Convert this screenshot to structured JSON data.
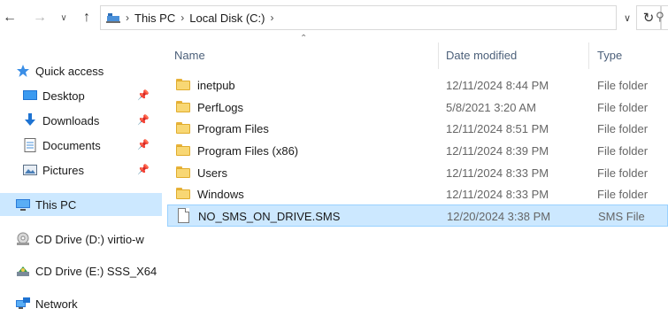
{
  "address_bar": {
    "breadcrumbs": [
      "This PC",
      "Local Disk (C:)"
    ]
  },
  "sidebar": {
    "items": [
      {
        "label": "Quick access",
        "icon": "star-icon",
        "pinned": false
      },
      {
        "label": "Desktop",
        "icon": "desktop-icon",
        "pinned": true
      },
      {
        "label": "Downloads",
        "icon": "download-icon",
        "pinned": true
      },
      {
        "label": "Documents",
        "icon": "documents-icon",
        "pinned": true
      },
      {
        "label": "Pictures",
        "icon": "pictures-icon",
        "pinned": true
      },
      {
        "label": "This PC",
        "icon": "computer-icon",
        "pinned": false,
        "selected": true
      },
      {
        "label": "CD Drive (D:) virtio-w",
        "icon": "cd-drive-icon",
        "pinned": false
      },
      {
        "label": "CD Drive (E:) SSS_X64",
        "icon": "cd-drive-icon",
        "pinned": false
      },
      {
        "label": "Network",
        "icon": "network-icon",
        "pinned": false
      }
    ]
  },
  "columns": {
    "name": "Name",
    "date": "Date modified",
    "type": "Type"
  },
  "files": [
    {
      "name": "inetpub",
      "date": "12/11/2024 8:44 PM",
      "type": "File folder",
      "icon": "folder-icon"
    },
    {
      "name": "PerfLogs",
      "date": "5/8/2021 3:20 AM",
      "type": "File folder",
      "icon": "folder-icon"
    },
    {
      "name": "Program Files",
      "date": "12/11/2024 8:51 PM",
      "type": "File folder",
      "icon": "folder-icon"
    },
    {
      "name": "Program Files (x86)",
      "date": "12/11/2024 8:39 PM",
      "type": "File folder",
      "icon": "folder-icon"
    },
    {
      "name": "Users",
      "date": "12/11/2024 8:33 PM",
      "type": "File folder",
      "icon": "folder-icon"
    },
    {
      "name": "Windows",
      "date": "12/11/2024 8:33 PM",
      "type": "File folder",
      "icon": "folder-icon"
    },
    {
      "name": "NO_SMS_ON_DRIVE.SMS",
      "date": "12/20/2024 3:38 PM",
      "type": "SMS File",
      "icon": "file-icon",
      "selected": true
    }
  ],
  "colors": {
    "selection": "#cce8ff",
    "selection_border": "#99d1ff",
    "header_text": "#4c607a"
  }
}
